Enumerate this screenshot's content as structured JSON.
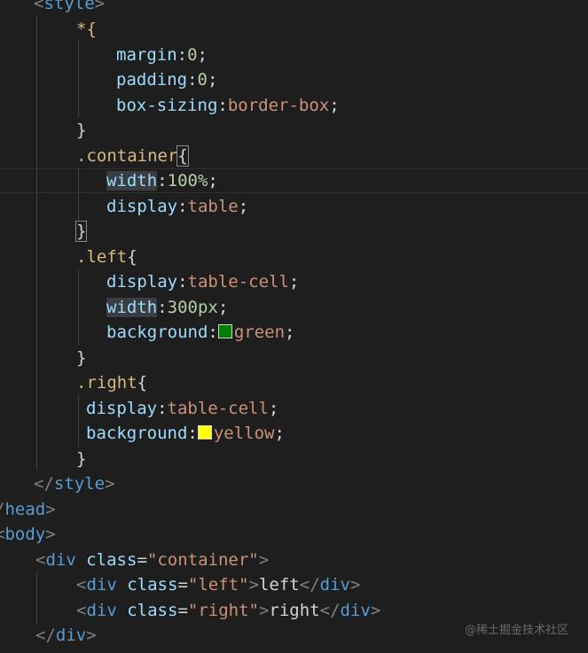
{
  "editor": {
    "lines": [
      {
        "style_open_text": "<style"
      },
      {
        "selector_all": "*{"
      },
      {
        "prop": "margin",
        "colon": ":",
        "value": "0",
        "semi": ";"
      },
      {
        "prop": "padding",
        "colon": ":",
        "value": "0",
        "semi": ";"
      },
      {
        "prop": "box-sizing",
        "colon": ":",
        "value": "border-box",
        "semi": ";"
      },
      {
        "close": "}"
      },
      {
        "selector": ".container",
        "open": "{"
      },
      {
        "prop": "width",
        "colon": ":",
        "value": "100%",
        "semi": ";"
      },
      {
        "prop": "display",
        "colon": ":",
        "value": "table",
        "semi": ";"
      },
      {
        "close": "}"
      },
      {
        "selector": ".left",
        "open": "{"
      },
      {
        "prop": "display",
        "colon": ":",
        "value": "table-cell",
        "semi": ";"
      },
      {
        "prop": "width",
        "colon": ":",
        "value": "300px",
        "semi": ";"
      },
      {
        "prop": "background",
        "colon": ":",
        "value": "green",
        "semi": ";",
        "swatch": "#008000"
      },
      {
        "close": "}"
      },
      {
        "selector": ".right",
        "open": "{"
      },
      {
        "prop": "display",
        "colon": ":",
        "value": "table-cell",
        "semi": ";"
      },
      {
        "prop": "background",
        "colon": ":",
        "value": "yellow",
        "semi": ";",
        "swatch": "#ffff00"
      },
      {
        "close": "}"
      },
      {
        "tag_close": "</style>"
      },
      {
        "tag_close": "/head>"
      },
      {
        "tag_open": "body>"
      },
      {
        "tag": "<div",
        "attr": "class",
        "eq": "=",
        "str": "\"container\"",
        "end": ">"
      },
      {
        "tag": "<div",
        "attr": "class",
        "eq": "=",
        "str": "\"left\"",
        "end": ">",
        "text": "left",
        "close": "</div>"
      },
      {
        "tag": "<div",
        "attr": "class",
        "eq": "=",
        "str": "\"right\"",
        "end": ">",
        "text": "right",
        "close": "</div>"
      },
      {
        "tag_close": "</div>"
      }
    ]
  },
  "watermark": "@稀土掘金技术社区"
}
